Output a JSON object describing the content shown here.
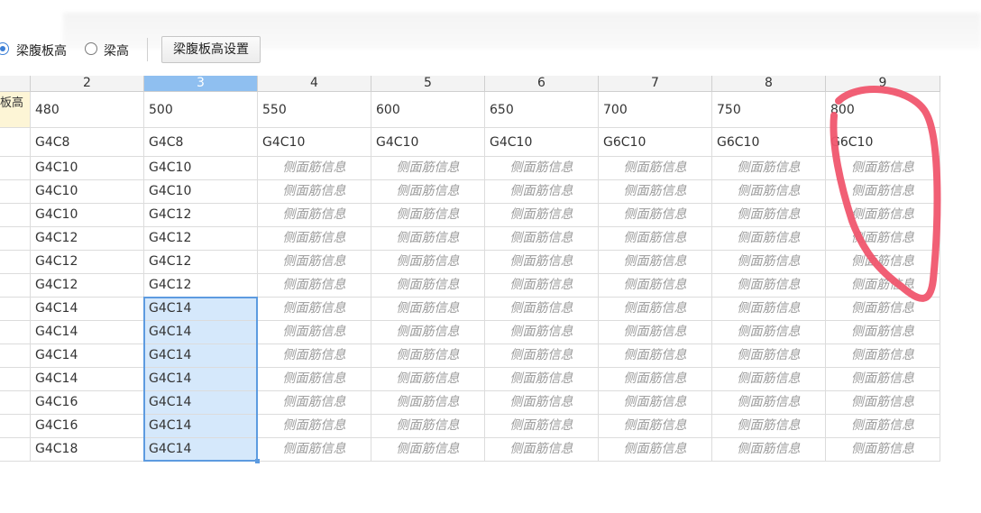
{
  "toolbar": {
    "option_web_height": "梁腹板高",
    "option_beam_height": "梁高",
    "settings_button": "梁腹板高设置"
  },
  "table": {
    "columns": [
      "2",
      "3",
      "4",
      "5",
      "6",
      "7",
      "8",
      "9"
    ],
    "selected_column": "3",
    "corner_label": "板高",
    "height_row": [
      "480",
      "500",
      "550",
      "600",
      "650",
      "700",
      "750",
      "800"
    ],
    "rows": [
      [
        "G4C8",
        "G4C8",
        "G4C10",
        "G4C10",
        "G4C10",
        "G6C10",
        "G6C10",
        "G6C10"
      ],
      [
        "G4C10",
        "G4C10",
        "侧面筋信息",
        "侧面筋信息",
        "侧面筋信息",
        "侧面筋信息",
        "侧面筋信息",
        "侧面筋信息"
      ],
      [
        "G4C10",
        "G4C10",
        "侧面筋信息",
        "侧面筋信息",
        "侧面筋信息",
        "侧面筋信息",
        "侧面筋信息",
        "侧面筋信息"
      ],
      [
        "G4C10",
        "G4C12",
        "侧面筋信息",
        "侧面筋信息",
        "侧面筋信息",
        "侧面筋信息",
        "侧面筋信息",
        "侧面筋信息"
      ],
      [
        "G4C12",
        "G4C12",
        "侧面筋信息",
        "侧面筋信息",
        "侧面筋信息",
        "侧面筋信息",
        "侧面筋信息",
        "侧面筋信息"
      ],
      [
        "G4C12",
        "G4C12",
        "侧面筋信息",
        "侧面筋信息",
        "侧面筋信息",
        "侧面筋信息",
        "侧面筋信息",
        "侧面筋信息"
      ],
      [
        "G4C12",
        "G4C12",
        "侧面筋信息",
        "侧面筋信息",
        "侧面筋信息",
        "侧面筋信息",
        "侧面筋信息",
        "侧面筋信息"
      ],
      [
        "G4C14",
        "G4C14",
        "侧面筋信息",
        "侧面筋信息",
        "侧面筋信息",
        "侧面筋信息",
        "侧面筋信息",
        "侧面筋信息"
      ],
      [
        "G4C14",
        "G4C14",
        "侧面筋信息",
        "侧面筋信息",
        "侧面筋信息",
        "侧面筋信息",
        "侧面筋信息",
        "侧面筋信息"
      ],
      [
        "G4C14",
        "G4C14",
        "侧面筋信息",
        "侧面筋信息",
        "侧面筋信息",
        "侧面筋信息",
        "侧面筋信息",
        "侧面筋信息"
      ],
      [
        "G4C14",
        "G4C14",
        "侧面筋信息",
        "侧面筋信息",
        "侧面筋信息",
        "侧面筋信息",
        "侧面筋信息",
        "侧面筋信息"
      ],
      [
        "G4C16",
        "G4C14",
        "侧面筋信息",
        "侧面筋信息",
        "侧面筋信息",
        "侧面筋信息",
        "侧面筋信息",
        "侧面筋信息"
      ],
      [
        "G4C16",
        "G4C14",
        "侧面筋信息",
        "侧面筋信息",
        "侧面筋信息",
        "侧面筋信息",
        "侧面筋信息",
        "侧面筋信息"
      ],
      [
        "G4C18",
        "G4C14",
        "侧面筋信息",
        "侧面筋信息",
        "侧面筋信息",
        "侧面筋信息",
        "侧面筋信息",
        "侧面筋信息"
      ]
    ],
    "placeholder_text": "侧面筋信息"
  },
  "colors": {
    "accent": "#3c7fd6",
    "selected_header": "#8fbff0",
    "selected_cells": "#d5e8fb",
    "annotation": "#f0566e"
  }
}
